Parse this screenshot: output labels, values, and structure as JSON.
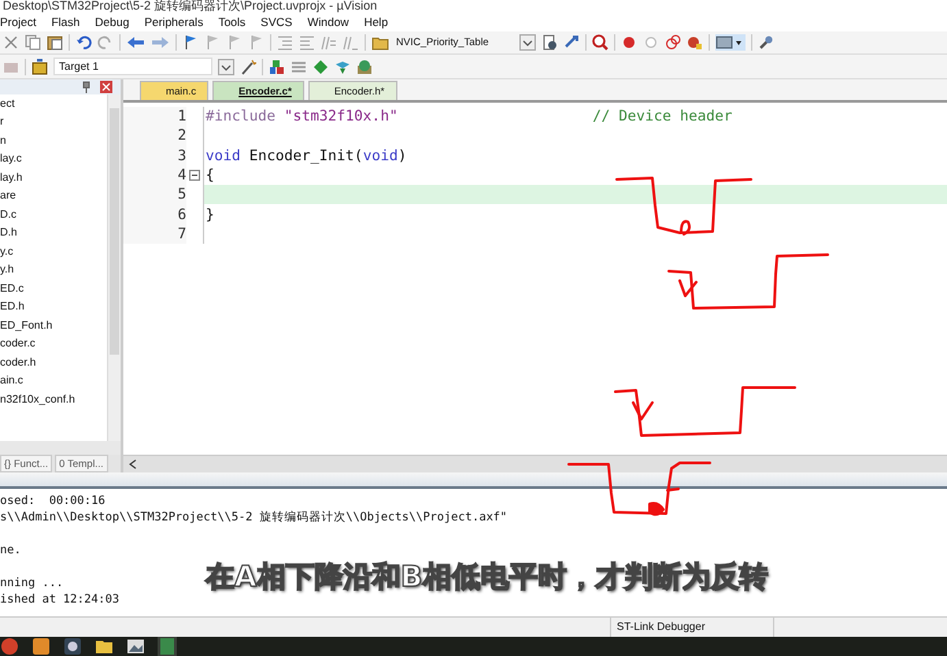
{
  "window": {
    "title": "Desktop\\STM32Project\\5-2 旋转编码器计次\\Project.uvprojx - µVision"
  },
  "menu": [
    "Project",
    "Flash",
    "Debug",
    "Peripherals",
    "Tools",
    "SVCS",
    "Window",
    "Help"
  ],
  "toolbar": {
    "combo": "NVIC_Priority_Table",
    "target": "Target 1"
  },
  "project_tree": {
    "items": [
      "ect",
      "r",
      "n",
      "lay.c",
      "lay.h",
      "are",
      "D.c",
      "D.h",
      "y.c",
      "y.h",
      "ED.c",
      "ED.h",
      "ED_Font.h",
      "coder.c",
      "coder.h",
      "ain.c",
      "n32f10x_conf.h"
    ],
    "tabs": [
      {
        "label": "Funct...",
        "icon": "{}",
        "selected": false
      },
      {
        "label": "Templ...",
        "icon": "0",
        "selected": false
      }
    ]
  },
  "editor_tabs": [
    {
      "label": "main.c",
      "selected": false,
      "color": "#f5d76e"
    },
    {
      "label": "Encoder.c*",
      "selected": true,
      "color": "#c9e4c0"
    },
    {
      "label": "Encoder.h*",
      "selected": false,
      "color": "#e3efd9"
    }
  ],
  "code": [
    {
      "number": "1",
      "current": false,
      "tokens": [
        {
          "kind": "preproc",
          "text": "#include"
        },
        {
          "kind": "string",
          "text": "\"stm32f10x.h\""
        },
        {
          "kind": "comment",
          "text": "// Device header"
        }
      ]
    },
    {
      "number": "2",
      "current": false
    },
    {
      "number": "3",
      "current": false,
      "tokens": [
        {
          "kind": "keyword",
          "text": "void"
        },
        {
          "kind": "plain",
          "text": " Encoder_Init("
        },
        {
          "kind": "keyword",
          "text": "void"
        },
        {
          "kind": "plain",
          "text": ")"
        }
      ]
    },
    {
      "number": "4",
      "current": false,
      "fold": true,
      "tokens": [
        {
          "kind": "plain",
          "text": "{"
        }
      ]
    },
    {
      "number": "5",
      "current": true
    },
    {
      "number": "6",
      "current": false,
      "tokens": [
        {
          "kind": "plain",
          "text": "}"
        }
      ]
    },
    {
      "number": "7",
      "current": false
    }
  ],
  "output": [
    {
      "text": "osed:  00:00:16",
      "space_before": false
    },
    {
      "text": "s\\\\Admin\\\\Desktop\\\\STM32Project\\\\5-2 旋转编码器计次\\\\Objects\\\\Project.axf\"",
      "space_before": false
    },
    {
      "text": "ne.",
      "space_before": true
    },
    {
      "text": "nning ...",
      "space_before": true
    },
    {
      "text": "ished at 12:24:03",
      "space_before": false
    }
  ],
  "subtitle": "在A相下降沿和B相低电平时，才判断为反转",
  "status_bar": {
    "debugger": "ST-Link Debugger"
  }
}
